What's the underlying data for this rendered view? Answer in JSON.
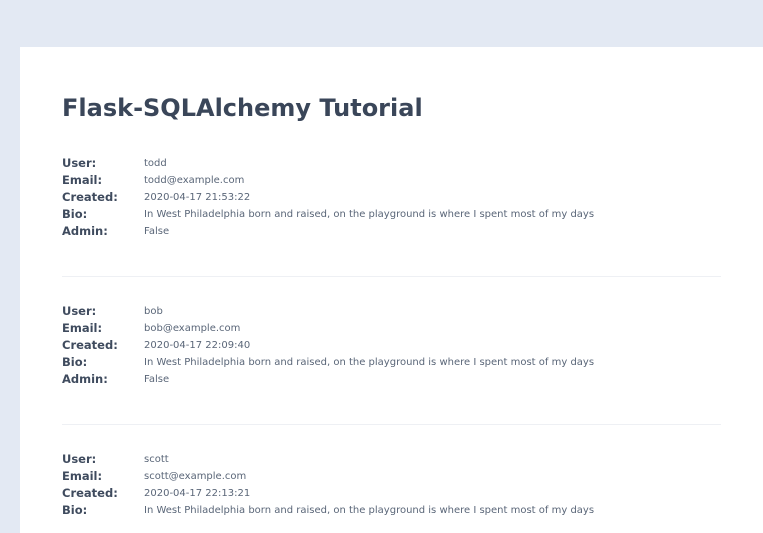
{
  "page": {
    "title": "Flask-SQLAlchemy Tutorial"
  },
  "labels": {
    "user": "User:",
    "email": "Email:",
    "created": "Created:",
    "bio": "Bio:",
    "admin": "Admin:"
  },
  "users": [
    {
      "username": "todd",
      "email": "todd@example.com",
      "created": "2020-04-17 21:53:22",
      "bio": "In West Philadelphia born and raised, on the playground is where I spent most of my days",
      "admin": "False"
    },
    {
      "username": "bob",
      "email": "bob@example.com",
      "created": "2020-04-17 22:09:40",
      "bio": "In West Philadelphia born and raised, on the playground is where I spent most of my days",
      "admin": "False"
    },
    {
      "username": "scott",
      "email": "scott@example.com",
      "created": "2020-04-17 22:13:21",
      "bio": "In West Philadelphia born and raised, on the playground is where I spent most of my days",
      "admin": ""
    }
  ],
  "colors": {
    "page_background": "#e3e9f3",
    "card_background": "#ffffff",
    "heading": "#3a4659",
    "text": "#5a6678"
  }
}
